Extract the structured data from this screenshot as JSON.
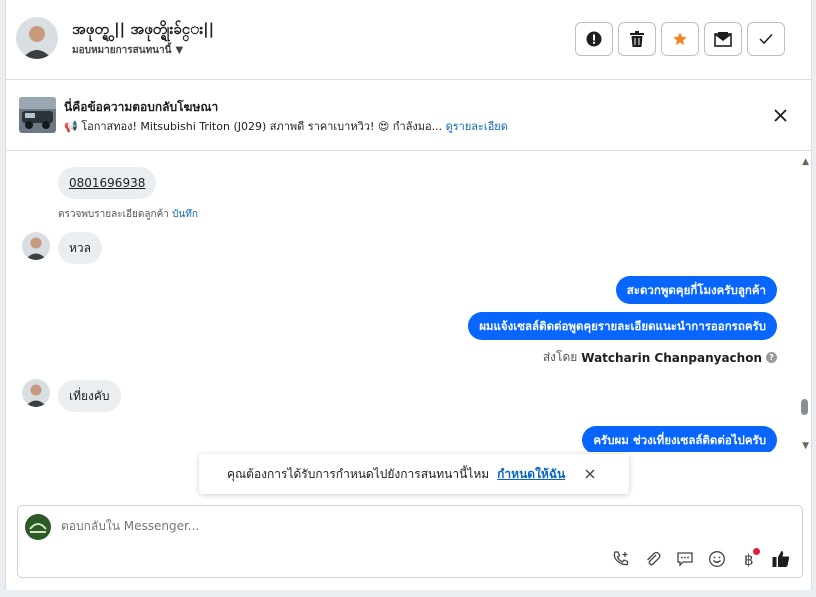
{
  "header": {
    "contact_name": "အဖုတ္ရွ || အဖုတ္ရိုးခ်င္း||",
    "assign_label": "มอบหมายการสนทนานี้",
    "actions": [
      "spam-report",
      "delete",
      "star",
      "mark-unread",
      "done"
    ]
  },
  "ad": {
    "title": "นี่คือข้อความตอบกลับโฆษณา",
    "description": "📢 โอกาสทอง! Mitsubishi Triton (J029) สภาพดี ราคาเบาหวิว! 😍 กำลังมอ...",
    "details_link": "ดูรายละเอียด"
  },
  "messages": {
    "phone": "0801696938",
    "detected_text": "ตรวจพบรายละเอียดลูกค้า",
    "save_link": "บันทึก",
    "msg1": "หวล",
    "out1": "สะดวกพูดคุยกี่โมงครับลูกค้า",
    "out2": "ผมแจ้งเซลล์ติดต่อพูดคุยรายละเอียดแนะนำการออกรถครับ",
    "sent_by_prefix": "ส่งโดย",
    "sent_by_name": "Watcharin Chanpanyachon",
    "msg2": "เที่ยงคับ",
    "out3": "ครับผม ช่วงเที่ยงเซลล์ติดต่อไปครับ"
  },
  "toast": {
    "text": "คุณต้องการได้รับการกำหนดไปยังการสนทนานี้ไหม",
    "link": "กำหนดให้ฉัน"
  },
  "composer": {
    "placeholder": "ตอบกลับใน Messenger..."
  },
  "colors": {
    "brand_blue": "#0866ff",
    "link_blue": "#0a66c2",
    "star_orange": "#f5821f"
  }
}
